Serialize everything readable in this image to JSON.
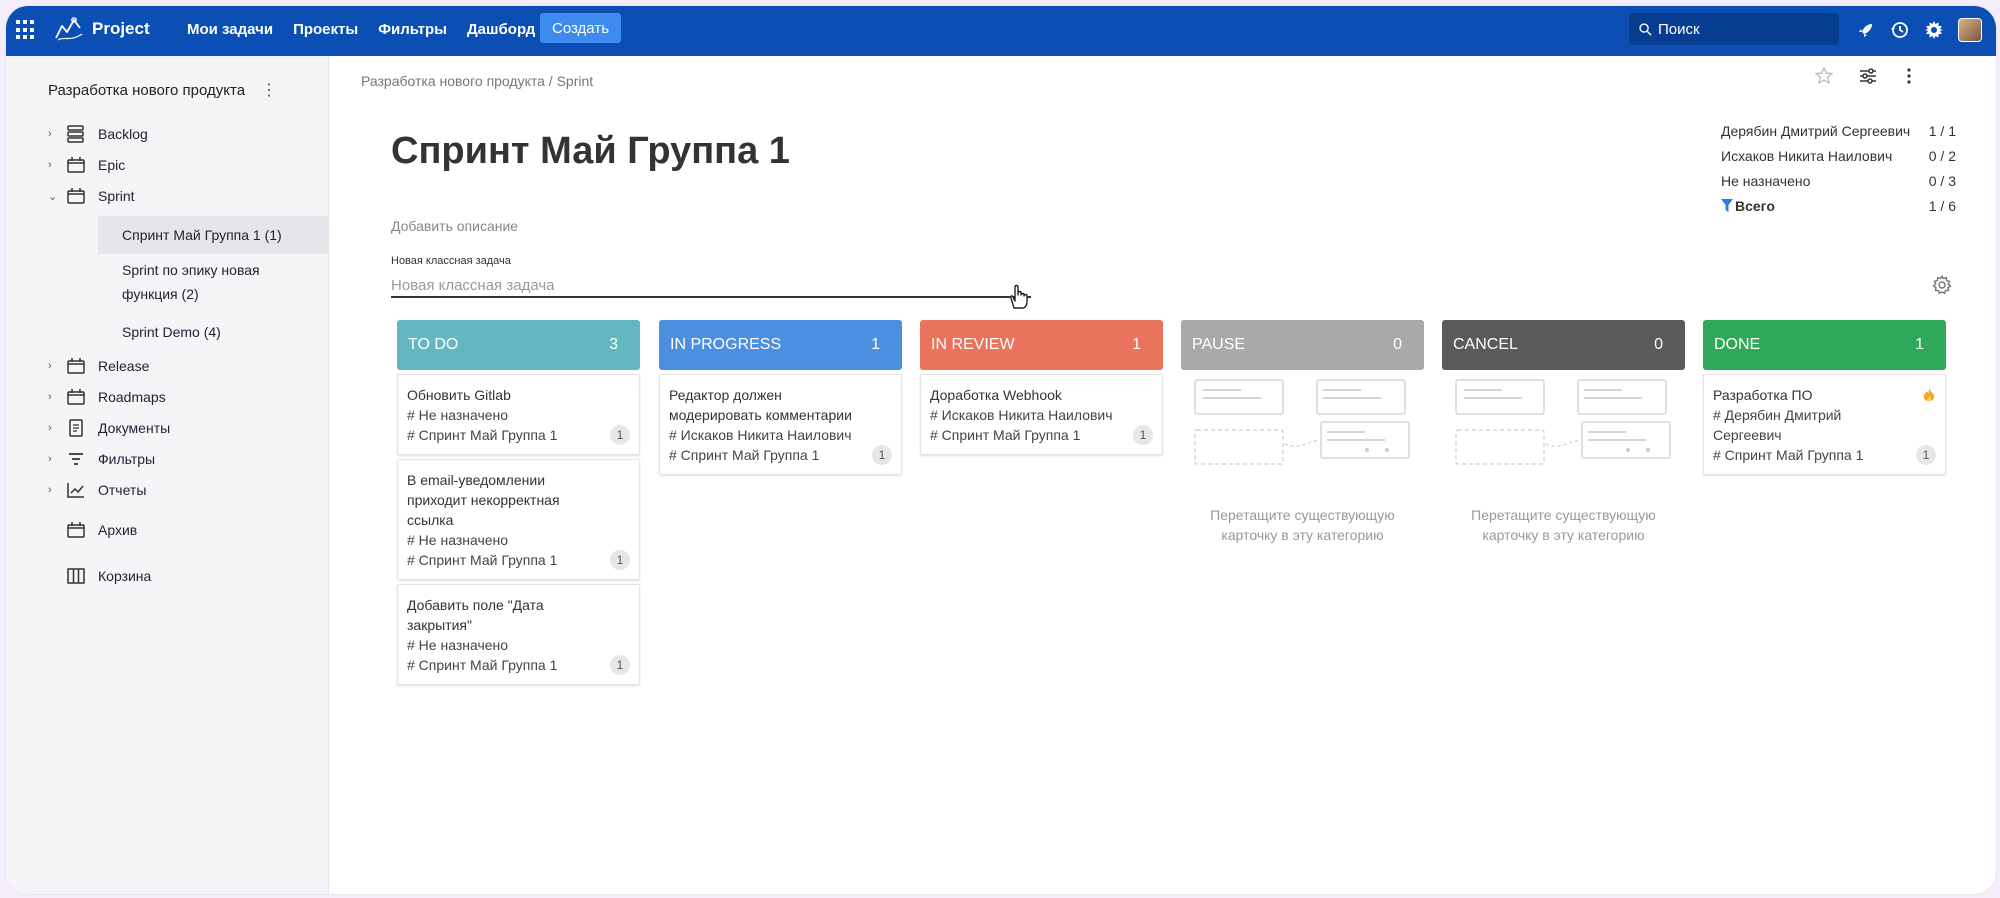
{
  "nav": {
    "logo": "Project",
    "links": [
      "Мои задачи",
      "Проекты",
      "Фильтры",
      "Дашборд"
    ],
    "create": "Создать",
    "search": "Поиск"
  },
  "sidebar": {
    "project": "Разработка нового продукта",
    "items": {
      "backlog": "Backlog",
      "epic": "Epic",
      "sprint": "Sprint",
      "release": "Release",
      "roadmaps": "Roadmaps",
      "docs": "Документы",
      "filters": "Фильтры",
      "reports": "Отчеты",
      "archive": "Архив",
      "trash": "Корзина"
    },
    "sprints": {
      "s1": "Спринт Май Группа 1 (1)",
      "s2a": "Sprint по эпику новая",
      "s2b": "функция (2)",
      "s3": "Sprint Demo (4)"
    }
  },
  "main": {
    "breadcrumb": "Разработка нового продукта / Sprint",
    "title": "Спринт Май Группа 1",
    "add_description": "Добавить описание",
    "new_task_label": "Новая классная задача",
    "new_task_placeholder": "Новая классная задача"
  },
  "stats": {
    "rows": [
      {
        "name": "Дерябин Дмитрий Сергеевич",
        "value": "1 / 1"
      },
      {
        "name": "Исхаков Никита Наилович",
        "value": "0 / 2"
      },
      {
        "name": "Не назначено",
        "value": "0 / 3"
      }
    ],
    "total_label": "Всего",
    "total_value": "1 / 6"
  },
  "colors": {
    "todo": "#63b7c1",
    "in_progress": "#4a8fe0",
    "in_review": "#e9735b",
    "pause": "#a9a9a9",
    "cancel": "#5a5a5a",
    "done": "#2fa85a"
  },
  "columns": {
    "todo": {
      "title": "TO DO",
      "count": "3",
      "cards": [
        {
          "title": "Обновить Gitlab",
          "assignee": "# Не назначено",
          "sprint": "# Спринт Май Группа 1",
          "badge": "1"
        },
        {
          "title_l1": "В email-уведомлении",
          "title_l2": "приходит некорректная",
          "title_l3": "ссылка",
          "assignee": "# Не назначено",
          "sprint": "# Спринт Май Группа 1",
          "badge": "1"
        },
        {
          "title_l1": "Добавить поле \"Дата",
          "title_l2": "закрытия\"",
          "assignee": "# Не назначено",
          "sprint": "# Спринт Май Группа 1",
          "badge": "1"
        }
      ]
    },
    "in_progress": {
      "title": "IN PROGRESS",
      "count": "1",
      "cards": [
        {
          "title_l1": "Редактор должен",
          "title_l2": "модерировать комментарии",
          "assignee": "# Искаков Никита Наилович",
          "sprint": "# Спринт Май Группа 1",
          "badge": "1"
        }
      ]
    },
    "in_review": {
      "title": "IN REVIEW",
      "count": "1",
      "cards": [
        {
          "title": "Доработка Webhook",
          "assignee": "# Искаков Никита Наилович",
          "sprint": "# Спринт Май Группа 1",
          "badge": "1"
        }
      ]
    },
    "pause": {
      "title": "PAUSE",
      "count": "0",
      "empty_l1": "Перетащите существующую",
      "empty_l2": "карточку в эту категорию"
    },
    "cancel": {
      "title": "CANCEL",
      "count": "0",
      "empty_l1": "Перетащите существующую",
      "empty_l2": "карточку в эту категорию"
    },
    "done": {
      "title": "DONE",
      "count": "1",
      "cards": [
        {
          "title": "Разработка ПО",
          "assignee_l1": "# Дерябин Дмитрий",
          "assignee_l2": "Сергеевич",
          "sprint": "# Спринт Май Группа 1",
          "badge": "1",
          "icon": "fire-icon"
        }
      ]
    }
  }
}
